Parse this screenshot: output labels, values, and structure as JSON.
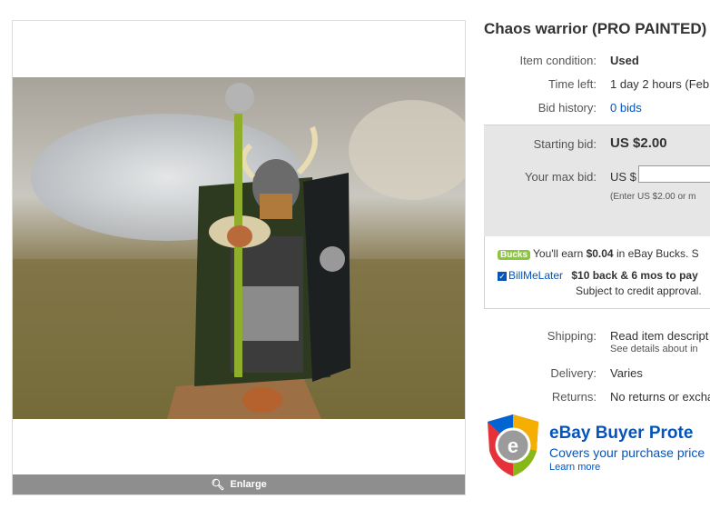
{
  "item": {
    "title": "Chaos warrior (PRO PAINTED)",
    "enlarge_label": "Enlarge"
  },
  "details": {
    "condition_label": "Item condition:",
    "condition_value": "Used",
    "time_left_label": "Time left:",
    "time_left_value": "1 day 2 hours (Feb",
    "bid_history_label": "Bid history:",
    "bid_history_value": "0 bids"
  },
  "bid": {
    "starting_label": "Starting bid:",
    "starting_value": "US $2.00",
    "max_label": "Your max bid:",
    "currency_prefix": "US $",
    "hint": "(Enter US $2.00 or m"
  },
  "promo": {
    "bucks_badge": "Bucks",
    "bucks_pre": "You'll earn ",
    "bucks_amount": "$0.04",
    "bucks_post": " in eBay Bucks. S",
    "bml_logo": "BillMeLater",
    "bml_offer": "$10 back & 6 mos to pay",
    "bml_note": "Subject to credit approval."
  },
  "shipping": {
    "shipping_label": "Shipping:",
    "shipping_value": "Read item descript",
    "shipping_sub": "See details about in",
    "delivery_label": "Delivery:",
    "delivery_value": "Varies",
    "returns_label": "Returns:",
    "returns_value": "No returns or excha"
  },
  "protection": {
    "title": "eBay Buyer Prote",
    "subtitle": "Covers your purchase price",
    "link": "Learn more"
  },
  "colors": {
    "link": "#0654ba",
    "bid_box": "#e6e6e6",
    "bucks_green": "#8cc63f"
  }
}
